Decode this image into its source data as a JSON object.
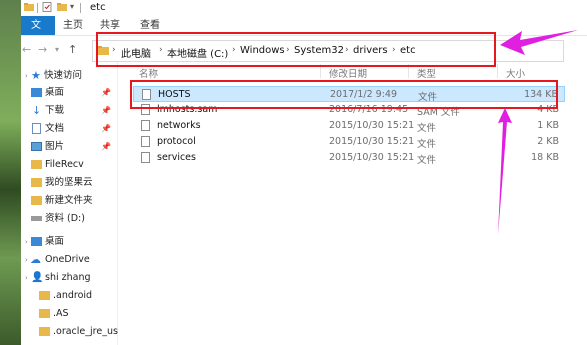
{
  "window": {
    "title": "etc"
  },
  "ribbon": {
    "tabs": [
      "文件",
      "主页",
      "共享",
      "查看"
    ]
  },
  "address": {
    "crumbs": [
      "此电脑",
      "本地磁盘 (C:)",
      "Windows",
      "System32",
      "drivers",
      "etc"
    ]
  },
  "nav": {
    "items": [
      {
        "label": "快速访问"
      },
      {
        "label": "桌面"
      },
      {
        "label": "下载"
      },
      {
        "label": "文档"
      },
      {
        "label": "图片"
      },
      {
        "label": "FileRecv"
      },
      {
        "label": "我的坚果云"
      },
      {
        "label": "新建文件夹"
      },
      {
        "label": "资料 (D:)"
      },
      {
        "label": "桌面"
      },
      {
        "label": "OneDrive"
      },
      {
        "label": "shi zhang"
      },
      {
        "label": ".android"
      },
      {
        "label": ".AS"
      },
      {
        "label": ".oracle_jre_us"
      }
    ]
  },
  "columns": {
    "name": "名称",
    "date": "修改日期",
    "type": "类型",
    "size": "大小"
  },
  "files": [
    {
      "name": "HOSTS",
      "date": "2017/1/2 9:49",
      "type": "文件",
      "size": "134 KB",
      "selected": true
    },
    {
      "name": "lmhosts.sam",
      "date": "2016/7/16 19:45",
      "type": "SAM 文件",
      "size": "4 KB",
      "selected": false
    },
    {
      "name": "networks",
      "date": "2015/10/30 15:21",
      "type": "文件",
      "size": "1 KB",
      "selected": false
    },
    {
      "name": "protocol",
      "date": "2015/10/30 15:21",
      "type": "文件",
      "size": "2 KB",
      "selected": false
    },
    {
      "name": "services",
      "date": "2015/10/30 15:21",
      "type": "文件",
      "size": "18 KB",
      "selected": false
    }
  ],
  "colors": {
    "annotation_red": "#e5171f",
    "annotation_arrow": "#e020e0",
    "selection": "#cce8ff",
    "file_tab": "#1979ca"
  }
}
